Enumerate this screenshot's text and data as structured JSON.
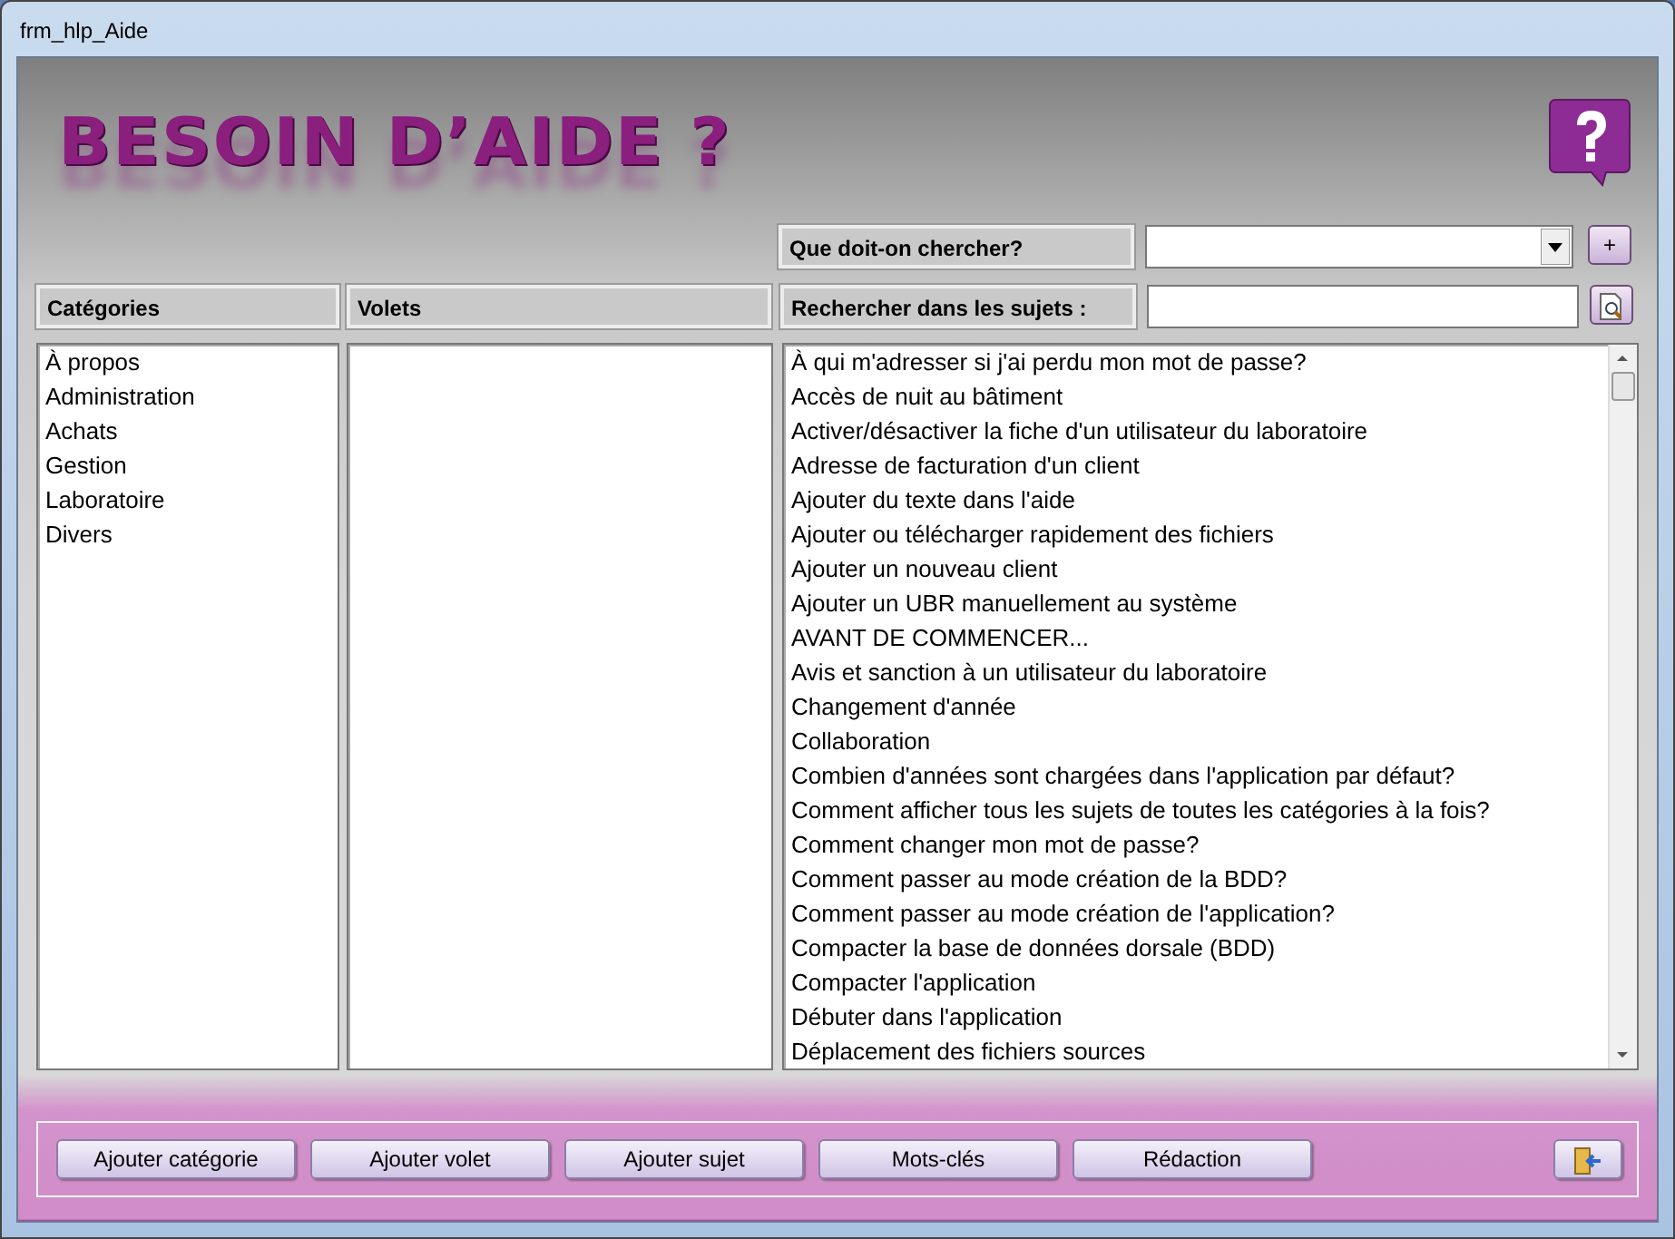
{
  "window": {
    "title": "frm_hlp_Aide"
  },
  "heading": "BESOIN D’AIDE ?",
  "query": {
    "label": "Que doit-on chercher?",
    "add_button": "+"
  },
  "search": {
    "label": "Rechercher dans les sujets :"
  },
  "columns": {
    "categories": "Catégories",
    "panes": "Volets"
  },
  "categories": [
    "À propos",
    "Administration",
    "Achats",
    "Gestion",
    "Laboratoire",
    "Divers"
  ],
  "topics": [
    "À qui m'adresser si j'ai perdu mon mot de passe?",
    "Accès de nuit au bâtiment",
    "Activer/désactiver la fiche d'un utilisateur du laboratoire",
    "Adresse de facturation d'un client",
    "Ajouter du texte dans l'aide",
    "Ajouter ou télécharger rapidement des fichiers",
    "Ajouter un nouveau client",
    "Ajouter un UBR manuellement au système",
    "AVANT DE COMMENCER...",
    "Avis et sanction à un utilisateur du laboratoire",
    "Changement d'année",
    "Collaboration",
    "Combien d'années sont chargées dans l'application par défaut?",
    "Comment afficher tous les sujets de toutes les catégories à la fois?",
    "Comment changer mon mot de passe?",
    "Comment passer au mode création de la BDD?",
    "Comment passer au mode création de l'application?",
    "Compacter la base de données dorsale (BDD)",
    "Compacter l'application",
    "Débuter dans l'application",
    "Déplacement des fichiers sources"
  ],
  "buttons": [
    "Ajouter catégorie",
    "Ajouter volet",
    "Ajouter sujet",
    "Mots-clés",
    "Rédaction"
  ]
}
